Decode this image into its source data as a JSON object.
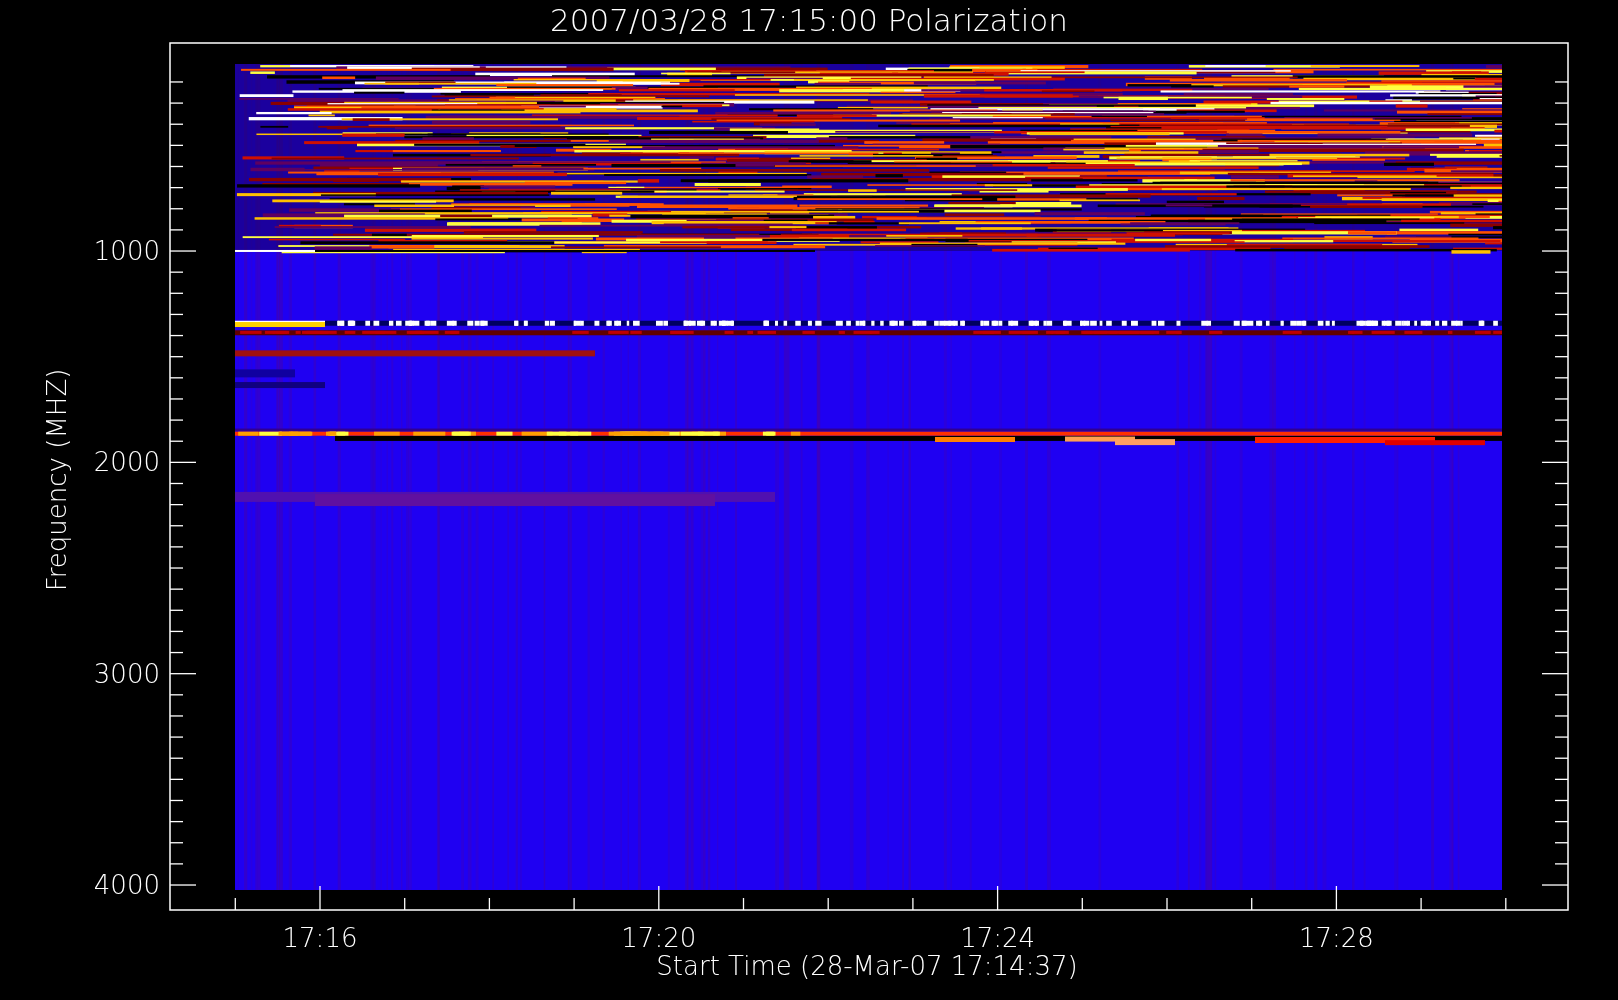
{
  "title": "2007/03/28 17:15:00 Polarization",
  "y_axis": {
    "label": "Frequency (MHZ)",
    "ticks": [
      "1000",
      "2000",
      "3000",
      "4000"
    ]
  },
  "x_axis": {
    "label": "Start Time (28-Mar-07 17:14:37)",
    "ticks": [
      "17:16",
      "17:20",
      "17:24",
      "17:28"
    ]
  }
}
